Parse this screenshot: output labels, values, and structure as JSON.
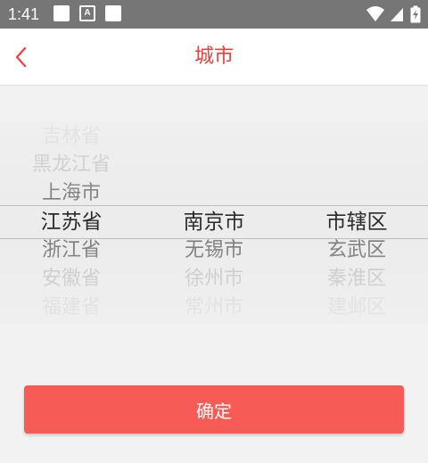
{
  "status_bar": {
    "time": "1:41",
    "notification_icons": [
      "image-icon",
      "a-letter-icon",
      "image-icon"
    ],
    "a_letter": "A",
    "right_icons": [
      "wifi-icon",
      "signal-icon",
      "battery-charging-icon"
    ]
  },
  "header": {
    "title": "城市",
    "back_icon": "chevron-left-icon",
    "accent_color": "#e8423d"
  },
  "picker": {
    "columns": [
      {
        "name": "province",
        "items": [
          "吉林省",
          "黑龙江省",
          "上海市",
          "江苏省",
          "浙江省",
          "安徽省",
          "福建省"
        ],
        "selected_index": 3
      },
      {
        "name": "city",
        "items": [
          "南京市",
          "无锡市",
          "徐州市",
          "常州市"
        ],
        "selected_index": 0
      },
      {
        "name": "district",
        "items": [
          "市辖区",
          "玄武区",
          "秦淮区",
          "建邺区"
        ],
        "selected_index": 0
      }
    ]
  },
  "footer": {
    "confirm_label": "确定",
    "confirm_color": "#f65c55"
  }
}
